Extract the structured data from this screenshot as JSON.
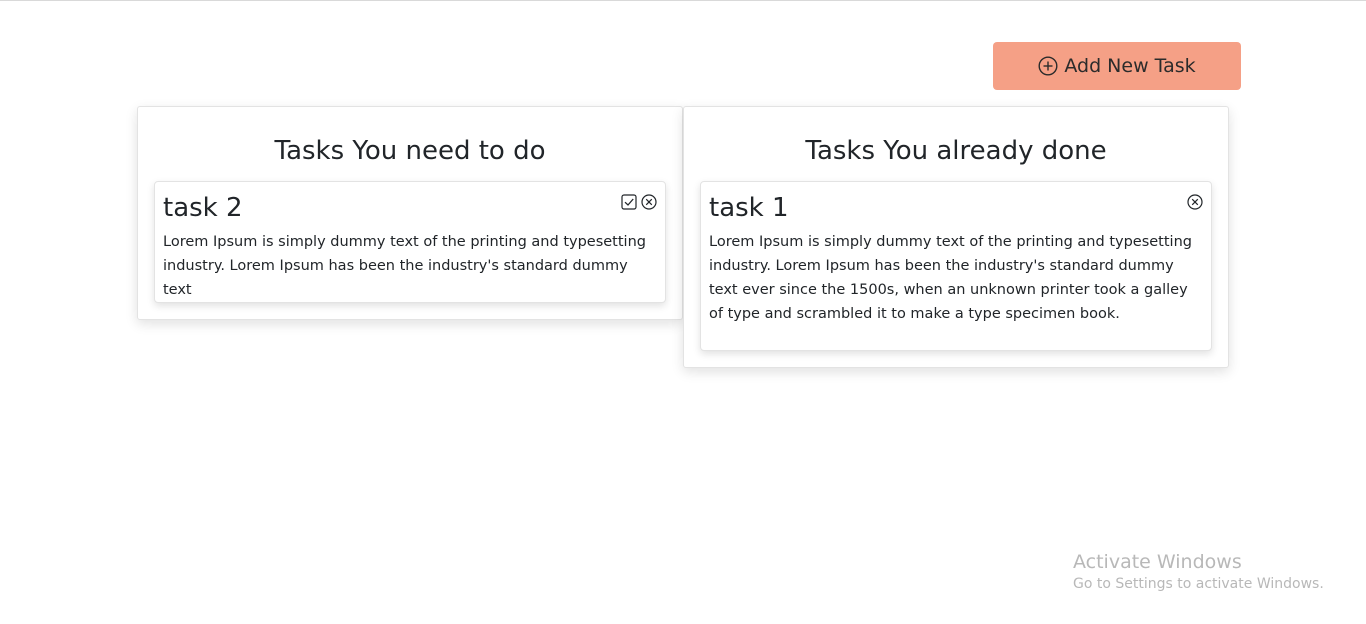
{
  "toolbar": {
    "add_label": "Add New Task",
    "add_icon": "plus-circle-icon",
    "accent": "#f5a086"
  },
  "todo": {
    "title": "Tasks You need to do",
    "tasks": [
      {
        "title": "task 2",
        "description": "Lorem Ipsum is simply dummy text of the printing and typesetting industry. Lorem Ipsum has been the industry's standard dummy text"
      }
    ]
  },
  "done": {
    "title": "Tasks You already done",
    "tasks": [
      {
        "title": "task 1",
        "description": "Lorem Ipsum is simply dummy text of the printing and typesetting industry. Lorem Ipsum has been the industry's standard dummy text ever since the 1500s, when an unknown printer took a galley of type and scrambled it to make a type specimen book."
      }
    ]
  },
  "watermark": {
    "title": "Activate Windows",
    "subtitle": "Go to Settings to activate Windows."
  }
}
